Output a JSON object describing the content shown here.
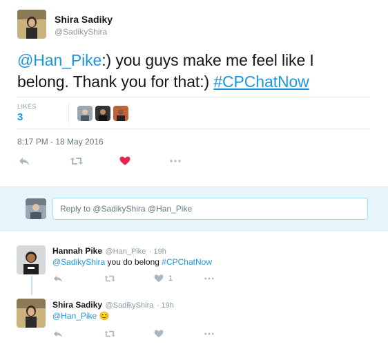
{
  "tweet": {
    "author_name": "Shira Sadiky",
    "author_handle": "@SadikyShira",
    "text_mention": "@Han_Pike",
    "text_part1": ":) you guys make me feel like I",
    "text_part2": "belong. Thank you for that:) ",
    "text_hashtag": "#CPChatNow",
    "likes_label": "LIKES",
    "likes_count": "3",
    "timestamp": "8:17 PM - 18 May 2016"
  },
  "reply_box": {
    "placeholder": "Reply to @SadikyShira @Han_Pike"
  },
  "replies": [
    {
      "name": "Hannah Pike",
      "handle": "@Han_Pike",
      "time": "· 19h",
      "mention": "@SadikyShira",
      "text": " you do belong ",
      "hashtag": "#CPChatNow",
      "like_count": "1"
    },
    {
      "name": "Shira Sadiky",
      "handle": "@SadikyShira",
      "time": "· 19h",
      "mention": "@Han_Pike",
      "emoji": "😊"
    }
  ],
  "colors": {
    "link": "#1b95e0",
    "heart": "#e2264d",
    "reply_bg": "#e8f5fd",
    "icon_grey": "#aab8c2"
  },
  "icons": [
    "reply-icon",
    "retweet-icon",
    "heart-icon",
    "more-icon"
  ]
}
